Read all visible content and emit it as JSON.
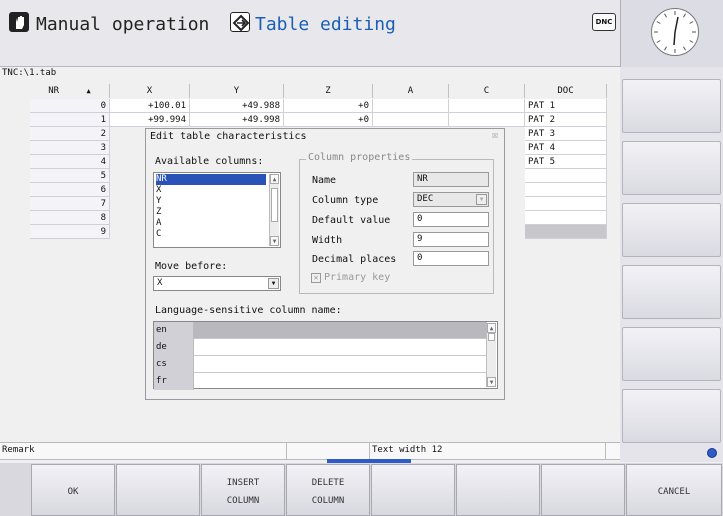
{
  "header": {
    "mode_primary": "Manual operation",
    "mode_secondary": "Table editing",
    "dnc_label": "DNC",
    "mode_primary_icon": "hand-icon",
    "mode_secondary_icon": "table-edit-icon",
    "accent_color": "#1b5fb4"
  },
  "path": "TNC:\\1.tab",
  "table": {
    "columns": [
      "NR",
      "X",
      "Y",
      "Z",
      "A",
      "C",
      "DOC"
    ],
    "sort_indicator": "▲",
    "rows": [
      {
        "NR": "0",
        "X": "+100.01",
        "Y": "+49.988",
        "Z": "+0",
        "A": "",
        "C": "",
        "DOC": "PAT 1"
      },
      {
        "NR": "1",
        "X": "+99.994",
        "Y": "+49.998",
        "Z": "+0",
        "A": "",
        "C": "",
        "DOC": "PAT 2"
      },
      {
        "NR": "2",
        "X": "",
        "Y": "",
        "Z": "",
        "A": "",
        "C": "",
        "DOC": "PAT 3"
      },
      {
        "NR": "3",
        "X": "",
        "Y": "",
        "Z": "",
        "A": "",
        "C": "",
        "DOC": "PAT 4"
      },
      {
        "NR": "4",
        "X": "",
        "Y": "",
        "Z": "",
        "A": "",
        "C": "",
        "DOC": "PAT 5"
      },
      {
        "NR": "5",
        "X": "",
        "Y": "",
        "Z": "",
        "A": "",
        "C": "",
        "DOC": ""
      },
      {
        "NR": "6",
        "X": "",
        "Y": "",
        "Z": "",
        "A": "",
        "C": "",
        "DOC": ""
      },
      {
        "NR": "7",
        "X": "",
        "Y": "",
        "Z": "",
        "A": "",
        "C": "",
        "DOC": ""
      },
      {
        "NR": "8",
        "X": "",
        "Y": "",
        "Z": "",
        "A": "",
        "C": "",
        "DOC": ""
      },
      {
        "NR": "9",
        "X": "",
        "Y": "",
        "Z": "",
        "A": "",
        "C": "",
        "DOC": ""
      }
    ]
  },
  "dialog": {
    "title": "Edit table characteristics",
    "close_glyph": "☒",
    "available_columns_label": "Available columns:",
    "available_columns": [
      "NR",
      "X",
      "Y",
      "Z",
      "A",
      "C"
    ],
    "selected_column": "NR",
    "move_before_label": "Move before:",
    "move_before_value": "X",
    "props_legend": "Column properties",
    "props": {
      "name_label": "Name",
      "name_value": "NR",
      "type_label": "Column type",
      "type_value": "DEC",
      "default_label": "Default value",
      "default_value": "0",
      "width_label": "Width",
      "width_value": "9",
      "decimals_label": "Decimal places",
      "decimals_value": "0"
    },
    "primary_key_label": "Primary key",
    "primary_key_checked": true,
    "lang_label": "Language-sensitive column name:",
    "languages": [
      "en",
      "de",
      "cs",
      "fr"
    ]
  },
  "status": {
    "remark_label": "Remark",
    "text_width": "Text width 12"
  },
  "softkeys": {
    "ok": "OK",
    "insert_l1": "INSERT",
    "insert_l2": "COLUMN",
    "delete_l1": "DELETE",
    "delete_l2": "COLUMN",
    "cancel": "CANCEL"
  }
}
